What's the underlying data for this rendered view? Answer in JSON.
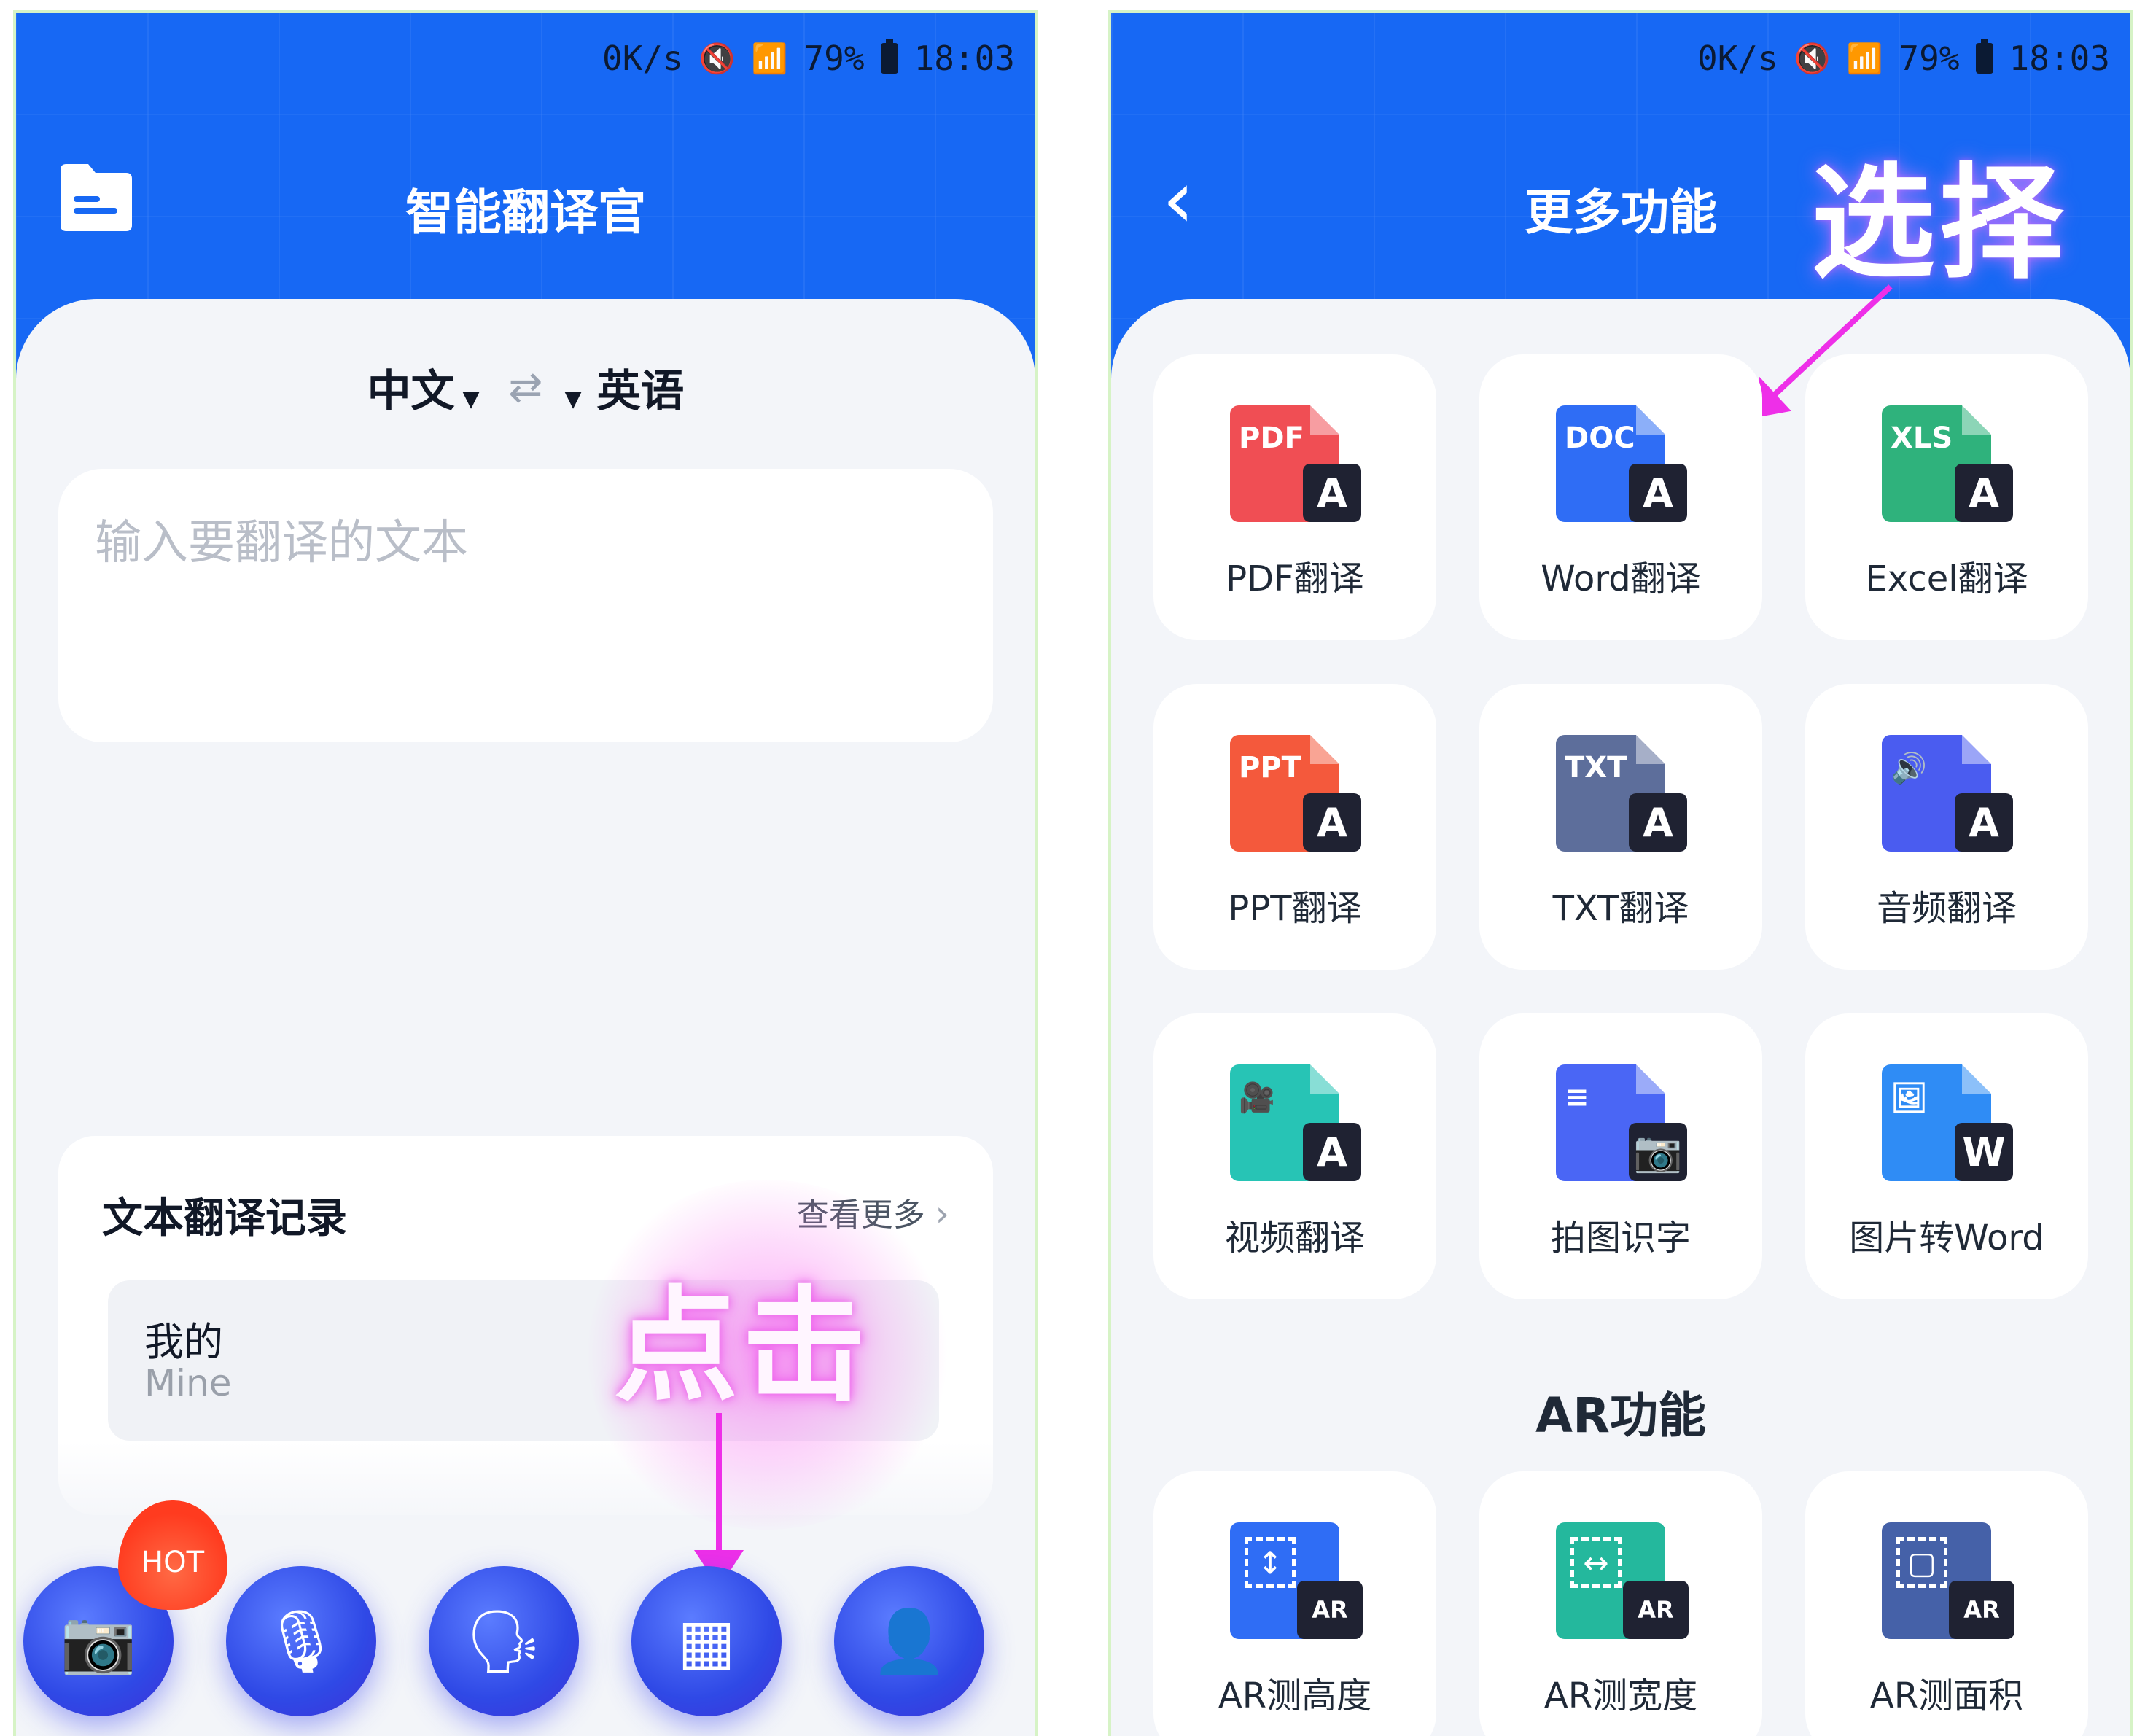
{
  "left": {
    "status": {
      "speed": "0K/s",
      "mute_icon": "mute-vibrate-icon",
      "wifi_icon": "wifi-icon",
      "signal_icon": "signal-icon",
      "battery": "79%",
      "time": "18:03"
    },
    "title": "智能翻译官",
    "folder_icon": "folder-icon",
    "lang_from": "中文",
    "lang_to": "英语",
    "swap_icon": "swap-icon",
    "input_placeholder": "输入要翻译的文本",
    "history": {
      "title": "文本翻译记录",
      "more": "查看更多",
      "item_zh": "我的",
      "item_en": "Mine"
    },
    "annotation": "点击",
    "nav": [
      {
        "name": "camera-icon",
        "glyph": "📷"
      },
      {
        "name": "microphone-icon",
        "glyph": "🎙"
      },
      {
        "name": "voice-person-icon",
        "glyph": "🗣"
      },
      {
        "name": "grid-apps-icon",
        "glyph": "▦"
      },
      {
        "name": "user-icon",
        "glyph": "👤"
      }
    ],
    "hot_badge": "HOT"
  },
  "right": {
    "status": {
      "speed": "0K/s",
      "battery": "79%",
      "time": "18:03"
    },
    "title": "更多功能",
    "back_icon": "back-chevron-icon",
    "annotation": "选择",
    "features": [
      {
        "label": "PDF翻译",
        "kind": "PDF",
        "color": "#f04e54",
        "badge": "A"
      },
      {
        "label": "Word翻译",
        "kind": "DOC",
        "color": "#2f6df5",
        "badge": "A"
      },
      {
        "label": "Excel翻译",
        "kind": "XLS",
        "color": "#2fb27c",
        "badge": "A"
      },
      {
        "label": "PPT翻译",
        "kind": "PPT",
        "color": "#f4593c",
        "badge": "A"
      },
      {
        "label": "TXT翻译",
        "kind": "TXT",
        "color": "#5d6e9b",
        "badge": "A"
      },
      {
        "label": "音频翻译",
        "kind": "🔊",
        "color": "#4a5cf0",
        "badge": "A"
      },
      {
        "label": "视频翻译",
        "kind": "🎥",
        "color": "#27c4b5",
        "badge": "A"
      },
      {
        "label": "拍图识字",
        "kind": "≡",
        "color": "#4a66f5",
        "badge": "📷"
      },
      {
        "label": "图片转Word",
        "kind": "🖼",
        "color": "#2f8cf5",
        "badge": "W"
      }
    ],
    "ar_section_title": "AR功能",
    "ar_features": [
      {
        "label": "AR测高度",
        "color": "#2f6df5",
        "glyph": "↕",
        "badge": "AR"
      },
      {
        "label": "AR测宽度",
        "color": "#24b89d",
        "glyph": "↔",
        "badge": "AR"
      },
      {
        "label": "AR测面积",
        "color": "#4561a8",
        "glyph": "▢",
        "badge": "AR"
      }
    ]
  }
}
